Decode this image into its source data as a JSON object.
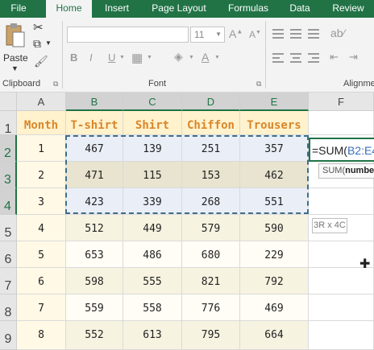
{
  "ribbon": {
    "tabs": [
      {
        "label": "File"
      },
      {
        "label": "Home"
      },
      {
        "label": "Insert"
      },
      {
        "label": "Page Layout"
      },
      {
        "label": "Formulas"
      },
      {
        "label": "Data"
      },
      {
        "label": "Review"
      }
    ],
    "active_tab": "Home",
    "clipboard": {
      "paste_label": "Paste",
      "group_label": "Clipboard"
    },
    "font": {
      "font_size": "11",
      "group_label": "Font",
      "bold": "B",
      "italic": "I",
      "underline": "U"
    },
    "alignment": {
      "group_label": "Alignme"
    }
  },
  "grid": {
    "columns": [
      "A",
      "B",
      "C",
      "D",
      "E",
      "F"
    ],
    "rows": [
      "1",
      "2",
      "3",
      "4",
      "5",
      "6",
      "7",
      "8",
      "9"
    ],
    "cells": [
      [
        "Month",
        "T-shirt",
        "Shirt",
        "Chiffon",
        "Trousers"
      ],
      [
        "1",
        "467",
        "139",
        "251",
        "357"
      ],
      [
        "2",
        "471",
        "115",
        "153",
        "462"
      ],
      [
        "3",
        "423",
        "339",
        "268",
        "551"
      ],
      [
        "4",
        "512",
        "449",
        "579",
        "590"
      ],
      [
        "5",
        "653",
        "486",
        "680",
        "229"
      ],
      [
        "6",
        "598",
        "555",
        "821",
        "792"
      ],
      [
        "7",
        "559",
        "558",
        "776",
        "469"
      ],
      [
        "8",
        "552",
        "613",
        "795",
        "664"
      ]
    ]
  },
  "formula_bar": {
    "prefix": "=SUM(",
    "ref": "B2:E4"
  },
  "tooltip": {
    "fn": "SUM(",
    "arg": "numbe"
  },
  "size_tip": "3R x 4C",
  "colors": {
    "accent": "#217346",
    "header_text": "#d9862b",
    "header_fill": "#fff2cc"
  }
}
